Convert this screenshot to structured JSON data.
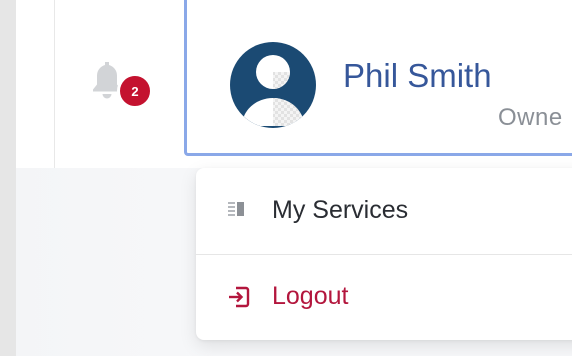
{
  "header": {
    "notifications": {
      "icon": "bell-icon",
      "count": "2"
    },
    "user": {
      "name": "Phil Smith",
      "role": "Owne",
      "avatar_icon": "user-avatar-icon"
    }
  },
  "user_menu": {
    "items": [
      {
        "label": "My Services",
        "icon": "services-list-icon"
      },
      {
        "label": "Logout",
        "icon": "logout-icon"
      }
    ]
  },
  "colors": {
    "brand_name": "#36579a",
    "avatar_bg": "#1b4a73",
    "badge": "#c4122f",
    "logout": "#b3163d",
    "focus_ring": "#8aa8e8"
  }
}
